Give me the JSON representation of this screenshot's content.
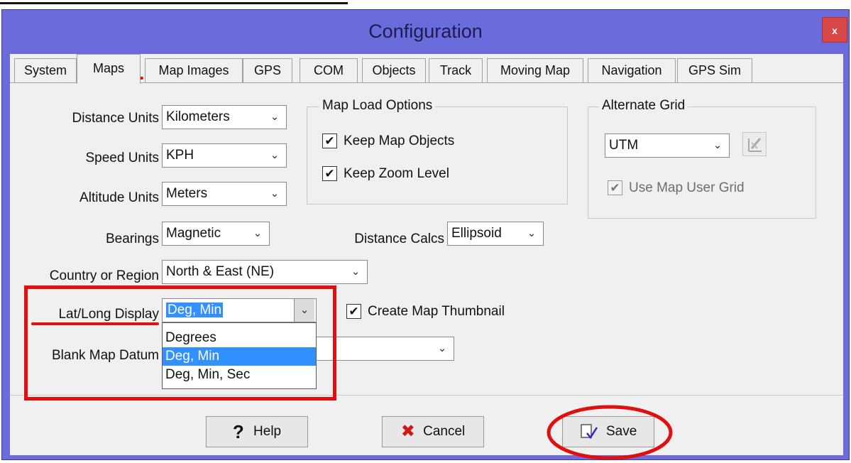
{
  "window": {
    "title": "Configuration",
    "close_label": "x"
  },
  "tabs": [
    {
      "label": "System"
    },
    {
      "label": "Maps"
    },
    {
      "label": "Map Images"
    },
    {
      "label": "GPS"
    },
    {
      "label": "COM"
    },
    {
      "label": "Objects"
    },
    {
      "label": "Track"
    },
    {
      "label": "Moving Map"
    },
    {
      "label": "Navigation"
    },
    {
      "label": "GPS Sim"
    }
  ],
  "active_tab": "Maps",
  "units": {
    "distance": {
      "label": "Distance Units",
      "value": "Kilometers"
    },
    "speed": {
      "label": "Speed Units",
      "value": "KPH"
    },
    "altitude": {
      "label": "Altitude Units",
      "value": "Meters"
    },
    "bearings": {
      "label": "Bearings",
      "value": "Magnetic"
    }
  },
  "distance_calcs": {
    "label": "Distance Calcs",
    "value": "Ellipsoid"
  },
  "country_region": {
    "label": "Country or Region",
    "value": "North & East (NE)"
  },
  "latlong_display": {
    "label": "Lat/Long Display",
    "value": "Deg, Min",
    "options": [
      "Degrees",
      "Deg, Min",
      "Deg, Min, Sec"
    ]
  },
  "blank_map_datum": {
    "label": "Blank Map Datum"
  },
  "map_load_options": {
    "title": "Map Load Options",
    "keep_map_objects": {
      "label": "Keep Map Objects",
      "checked": true
    },
    "keep_zoom_level": {
      "label": "Keep Zoom Level",
      "checked": true
    }
  },
  "alternate_grid": {
    "title": "Alternate Grid",
    "value": "UTM",
    "use_map_user_grid": {
      "label": "Use Map User Grid",
      "checked": true,
      "disabled": true
    }
  },
  "create_map_thumbnail": {
    "label": "Create Map Thumbnail",
    "checked": true
  },
  "buttons": {
    "help": "Help",
    "cancel": "Cancel",
    "save": "Save"
  },
  "glyphs": {
    "check": "✔",
    "chevron": "⌄",
    "help": "?",
    "cancel": "✖"
  },
  "colors": {
    "title_bar": "#6b6bdc",
    "highlight": "#e01010",
    "selection": "#3390ff"
  }
}
